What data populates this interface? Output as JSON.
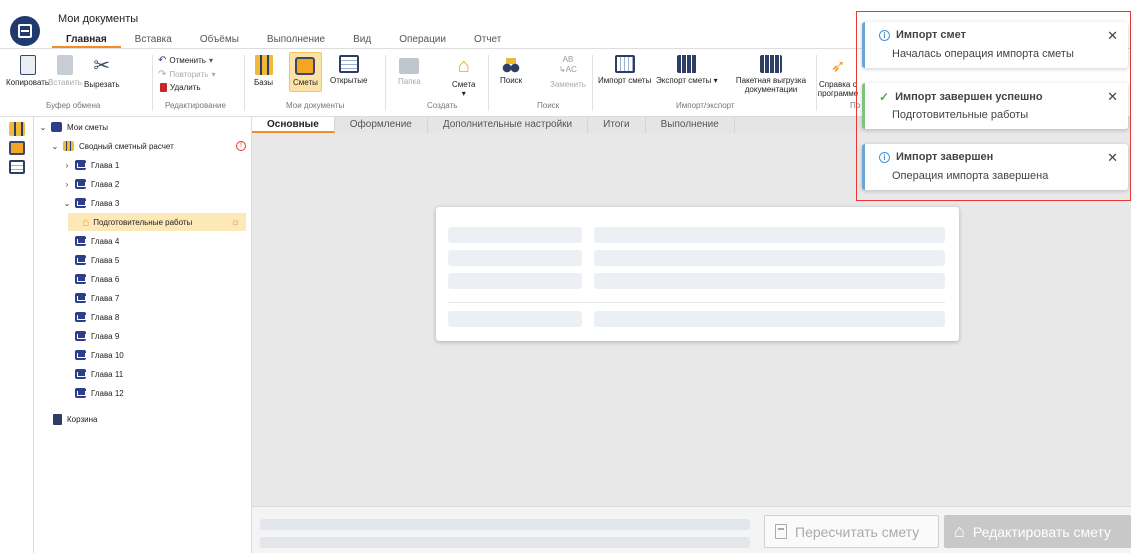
{
  "window": {
    "title": "Мои документы"
  },
  "tabs": [
    "Главная",
    "Вставка",
    "Объёмы",
    "Выполнение",
    "Вид",
    "Операции",
    "Отчет"
  ],
  "ribbon": {
    "clipboard": {
      "copy": "Копировать",
      "paste": "Вставить",
      "cut": "Вырезать",
      "label": "Буфер обмена"
    },
    "editing": {
      "undo": "Отменить",
      "redo": "Повторить",
      "delete": "Удалить",
      "label": "Редактирование"
    },
    "mydocs": {
      "bases": "Базы",
      "estimates": "Сметы",
      "opened": "Открытые",
      "label": "Мои документы"
    },
    "create": {
      "folder": "Папка",
      "estimate": "Смета",
      "label": "Создать"
    },
    "search": {
      "search": "Поиск",
      "replace": "Заменить",
      "label": "Поиск"
    },
    "importexport": {
      "import": "Импорт сметы",
      "export": "Экспорт сметы",
      "batch": "Пакетная выгрузка документации",
      "label": "Импорт/экспорт"
    },
    "help": {
      "help": "Справка о программе",
      "label": "По"
    }
  },
  "tree": {
    "root": "Мои сметы",
    "summary": "Сводный сметный расчет",
    "chapters": [
      "Глава 1",
      "Глава 2",
      "Глава 3"
    ],
    "selected": "Подготовительные работы",
    "chapters_more": [
      "Глава 4",
      "Глава 5",
      "Глава 6",
      "Глава 7",
      "Глава 8",
      "Глава 9",
      "Глава 10",
      "Глава 11",
      "Глава 12"
    ],
    "trash": "Корзина"
  },
  "content_tabs": [
    "Основные",
    "Оформление",
    "Дополнительные настройки",
    "Итоги",
    "Выполнение"
  ],
  "bottom": {
    "recalc": "Пересчитать смету",
    "edit": "Редактировать смету"
  },
  "notifications": [
    {
      "title": "Импорт смет",
      "body": "Началась операция импорта сметы",
      "kind": "info"
    },
    {
      "title": "Импорт завершен успешно",
      "body": "Подготовительные работы",
      "kind": "ok"
    },
    {
      "title": "Импорт завершен",
      "body": "Операция импорта завершена",
      "kind": "info"
    }
  ],
  "colors": {
    "accent": "#f28c28",
    "brand": "#1e3a6e",
    "alert": "#e53935"
  }
}
